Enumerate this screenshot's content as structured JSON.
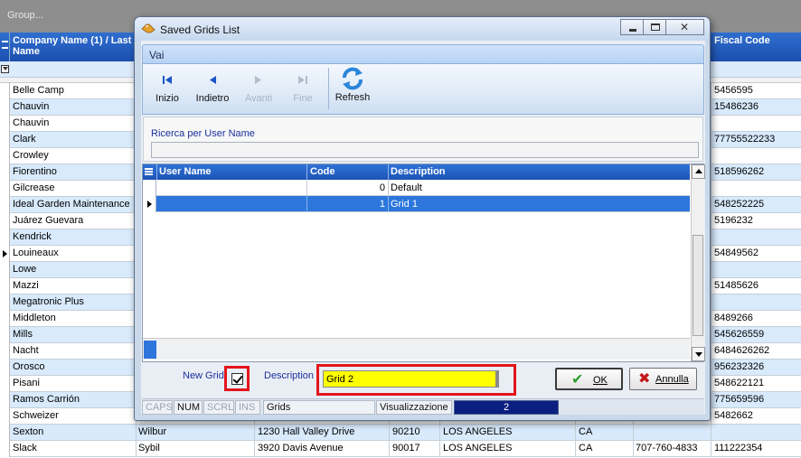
{
  "background": {
    "group_bar": "Group...",
    "header": {
      "company": "Company Name (1) / Last Name",
      "fiscal": "Fiscal Code"
    },
    "rows": [
      {
        "name": "Belle Camp",
        "first": "",
        "address": "",
        "zip": "",
        "city": "",
        "state": "",
        "phone": "",
        "fiscal": "5456595"
      },
      {
        "name": "Chauvin",
        "first": "",
        "address": "",
        "zip": "",
        "city": "",
        "state": "",
        "phone": "",
        "fiscal": "15486236"
      },
      {
        "name": "Chauvin",
        "first": "",
        "address": "",
        "zip": "",
        "city": "",
        "state": "",
        "phone": "",
        "fiscal": ""
      },
      {
        "name": "Clark",
        "first": "",
        "address": "",
        "zip": "",
        "city": "",
        "state": "",
        "phone": "",
        "fiscal": "77755522233"
      },
      {
        "name": "Crowley",
        "first": "",
        "address": "",
        "zip": "",
        "city": "",
        "state": "",
        "phone": "",
        "fiscal": ""
      },
      {
        "name": "Fiorentino",
        "first": "",
        "address": "",
        "zip": "",
        "city": "",
        "state": "",
        "phone": "",
        "fiscal": "518596262"
      },
      {
        "name": "Gilcrease",
        "first": "",
        "address": "",
        "zip": "",
        "city": "",
        "state": "",
        "phone": "",
        "fiscal": ""
      },
      {
        "name": "Ideal Garden Maintenance",
        "first": "",
        "address": "",
        "zip": "",
        "city": "",
        "state": "",
        "phone": "",
        "fiscal": "548252225"
      },
      {
        "name": "Juárez Guevara",
        "first": "",
        "address": "",
        "zip": "",
        "city": "",
        "state": "",
        "phone": "",
        "fiscal": "5196232"
      },
      {
        "name": "Kendrick",
        "first": "",
        "address": "",
        "zip": "",
        "city": "",
        "state": "",
        "phone": "",
        "fiscal": ""
      },
      {
        "name": "Louineaux",
        "first": "",
        "address": "",
        "zip": "",
        "city": "",
        "state": "",
        "phone": "",
        "fiscal": "54849562"
      },
      {
        "name": "Lowe",
        "first": "",
        "address": "",
        "zip": "",
        "city": "",
        "state": "",
        "phone": "",
        "fiscal": ""
      },
      {
        "name": "Mazzi",
        "first": "",
        "address": "",
        "zip": "",
        "city": "",
        "state": "",
        "phone": "",
        "fiscal": "51485626"
      },
      {
        "name": "Megatronic Plus",
        "first": "",
        "address": "",
        "zip": "",
        "city": "",
        "state": "",
        "phone": "",
        "fiscal": ""
      },
      {
        "name": "Middleton",
        "first": "",
        "address": "",
        "zip": "",
        "city": "",
        "state": "",
        "phone": "",
        "fiscal": "8489266"
      },
      {
        "name": "Mills",
        "first": "",
        "address": "",
        "zip": "",
        "city": "",
        "state": "",
        "phone": "",
        "fiscal": "545626559"
      },
      {
        "name": "Nacht",
        "first": "",
        "address": "",
        "zip": "",
        "city": "",
        "state": "",
        "phone": "",
        "fiscal": "6484626262"
      },
      {
        "name": "Orosco",
        "first": "",
        "address": "",
        "zip": "",
        "city": "",
        "state": "",
        "phone": "",
        "fiscal": "956232326"
      },
      {
        "name": "Pisani",
        "first": "",
        "address": "",
        "zip": "",
        "city": "",
        "state": "",
        "phone": "",
        "fiscal": "548622121"
      },
      {
        "name": "Ramos Carrión",
        "first": "",
        "address": "",
        "zip": "",
        "city": "",
        "state": "",
        "phone": "",
        "fiscal": "775659596"
      },
      {
        "name": "Schweizer",
        "first": "",
        "address": "",
        "zip": "",
        "city": "",
        "state": "",
        "phone": "",
        "fiscal": "5482662"
      },
      {
        "name": "Sexton",
        "first": "Wilbur",
        "address": "1230 Hall Valley Drive",
        "zip": "90210",
        "city": "LOS ANGELES",
        "state": "CA",
        "phone": "",
        "fiscal": ""
      },
      {
        "name": "Slack",
        "first": "Sybil",
        "address": "3920 Davis Avenue",
        "zip": "90017",
        "city": "LOS ANGELES",
        "state": "CA",
        "phone": "707-760-4833",
        "fiscal": "111222354"
      }
    ]
  },
  "dialog": {
    "title": "Saved Grids List",
    "menu": "Vai",
    "toolbar": {
      "first": "Inizio",
      "prev": "Indietro",
      "next": "Avanti",
      "last": "Fine",
      "refresh": "Refresh"
    },
    "search": {
      "label": "Ricerca per  User Name",
      "value": ""
    },
    "grid": {
      "columns": {
        "user": "User Name",
        "code": "Code",
        "description": "Description"
      },
      "rows": [
        {
          "user": "",
          "code": "0",
          "description": "Default"
        },
        {
          "user": "",
          "code": "1",
          "description": "Grid 1"
        }
      ]
    },
    "bottom": {
      "new_grid_label": "New Grid",
      "description_label": "Description",
      "description_value": "Grid 2",
      "ok": "OK",
      "cancel": "Annulla"
    },
    "status": {
      "caps": "CAPS",
      "num": "NUM",
      "scrl": "SCRL",
      "ins": "INS",
      "grids": "Grids",
      "visualizzazione": "Visualizzazione",
      "count": "2"
    }
  },
  "colors": {
    "header_blue": "#2f6fd0",
    "selected_row": "#2c76dc",
    "highlight_red": "#e3141c",
    "input_yellow": "#ffff00",
    "progress_navy": "#0a1f80"
  },
  "icons": [
    "first-record-icon",
    "previous-record-icon",
    "next-record-icon",
    "last-record-icon",
    "refresh-icon",
    "app-icon",
    "ok-check-icon",
    "cancel-x-icon"
  ]
}
